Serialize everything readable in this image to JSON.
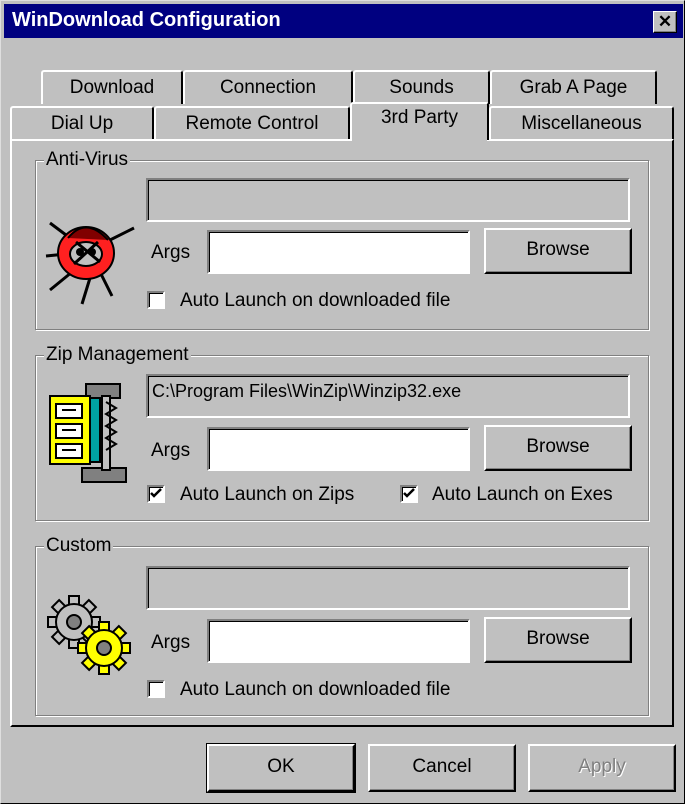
{
  "window": {
    "title": "WinDownload Configuration",
    "close_glyph": "✕"
  },
  "tabs_row1": [
    "Download",
    "Connection",
    "Sounds",
    "Grab A Page"
  ],
  "tabs_row2": [
    "Dial Up",
    "Remote Control",
    "3rd Party",
    "Miscellaneous"
  ],
  "active_tab": "3rd Party",
  "anti_virus": {
    "title": "Anti-Virus",
    "path": "",
    "args_label": "Args",
    "args_value": "",
    "browse_label": "Browse",
    "auto_launch_label": "Auto Launch on downloaded file",
    "auto_launch_checked": false,
    "icon": "bug-icon"
  },
  "zip": {
    "title": "Zip Management",
    "path": "C:\\Program Files\\WinZip\\Winzip32.exe",
    "args_label": "Args",
    "args_value": "",
    "browse_label": "Browse",
    "auto_zips_label": "Auto Launch on Zips",
    "auto_zips_checked": true,
    "auto_exes_label": "Auto Launch on Exes",
    "auto_exes_checked": true,
    "icon": "winzip-vise-icon"
  },
  "custom": {
    "title": "Custom",
    "path": "",
    "args_label": "Args",
    "args_value": "",
    "browse_label": "Browse",
    "auto_launch_label": "Auto Launch on downloaded file",
    "auto_launch_checked": false,
    "icon": "gears-icon"
  },
  "buttons": {
    "ok": "OK",
    "cancel": "Cancel",
    "apply": "Apply"
  }
}
